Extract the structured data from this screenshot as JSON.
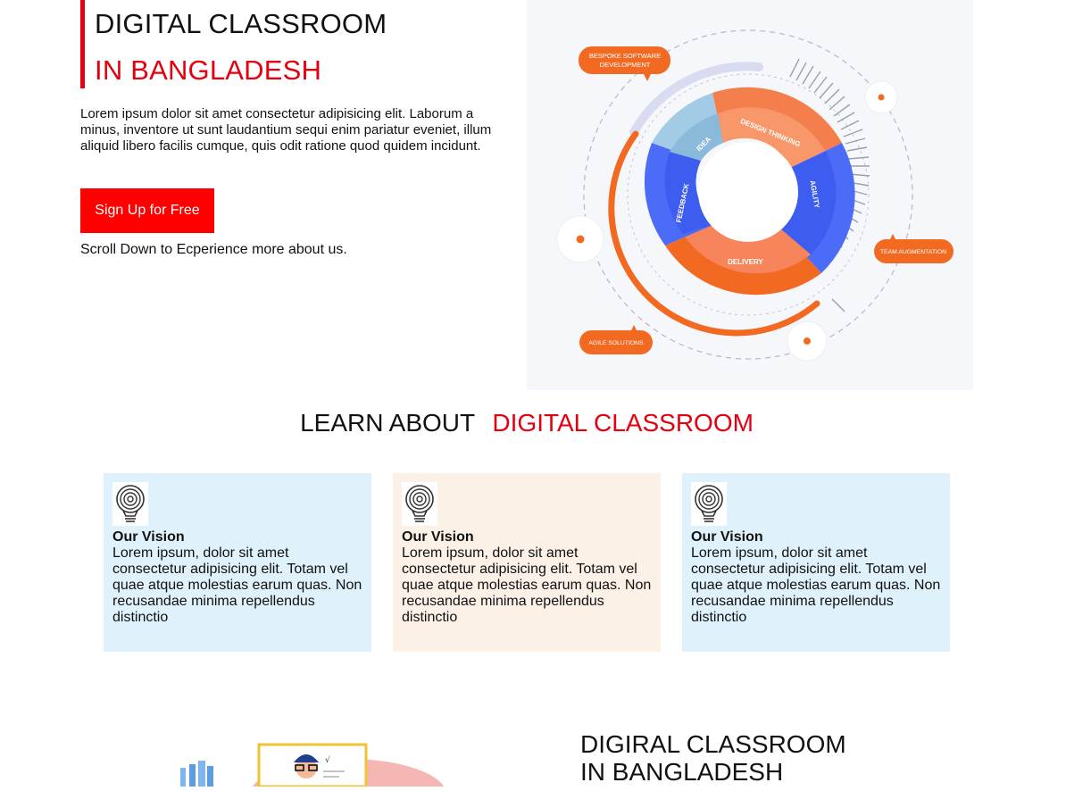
{
  "hero": {
    "title_line1": "DIGITAL CLASSROOM",
    "title_line2": "IN BANGLADESH",
    "description": "Lorem ipsum dolor sit amet consectetur adipisicing elit. Laborum a minus, inventore ut sunt laudantium sequi enim pariatur eveniet, illum aliquid libero facilis cumque, quis odit ratione quod quidem incidunt.",
    "signup_label": "Sign Up for Free",
    "scroll_text": "Scroll Down to Ecperience more about us.",
    "diagram": {
      "segments": [
        "DESIGN THINKING",
        "AGILITY",
        "DELIVERY",
        "FEEDBACK",
        "IDEA"
      ],
      "callouts": [
        "BESPOKE SOFTWARE",
        "DEVELOPMENT",
        "TEAM AUGMENTATION",
        "AGILE SOLUTIONS"
      ]
    }
  },
  "learn": {
    "heading_dark": "LEARN ABOUT",
    "heading_red": "DIGITAL CLASSROOM"
  },
  "cards": [
    {
      "title": "Our Vision",
      "text": "Lorem ipsum, dolor sit amet consectetur adipisicing elit. Totam vel quae atque molestias earum quas. Non recusandae minima repellendus distinctio",
      "bg": "#dff1fb",
      "icon": "lightbulb-icon"
    },
    {
      "title": "Our Vision",
      "text": "Lorem ipsum, dolor sit amet consectetur adipisicing elit. Totam vel quae atque molestias earum quas. Non recusandae minima repellendus distinctio",
      "bg": "#fbf1e6",
      "icon": "lightbulb-icon"
    },
    {
      "title": "Our Vision",
      "text": "Lorem ipsum, dolor sit amet consectetur adipisicing elit. Totam vel quae atque molestias earum quas. Non recusandae minima repellendus distinctio",
      "bg": "#dff1fb",
      "icon": "lightbulb-icon"
    }
  ],
  "bottom": {
    "title_line1": "DIGIRAL CLASSROOM",
    "title_line2": "IN BANGLADESH"
  },
  "colors": {
    "accent_red": "#e4000f",
    "button_red": "#ff0000",
    "orange": "#f26a21",
    "blue": "#4a6cf7"
  }
}
